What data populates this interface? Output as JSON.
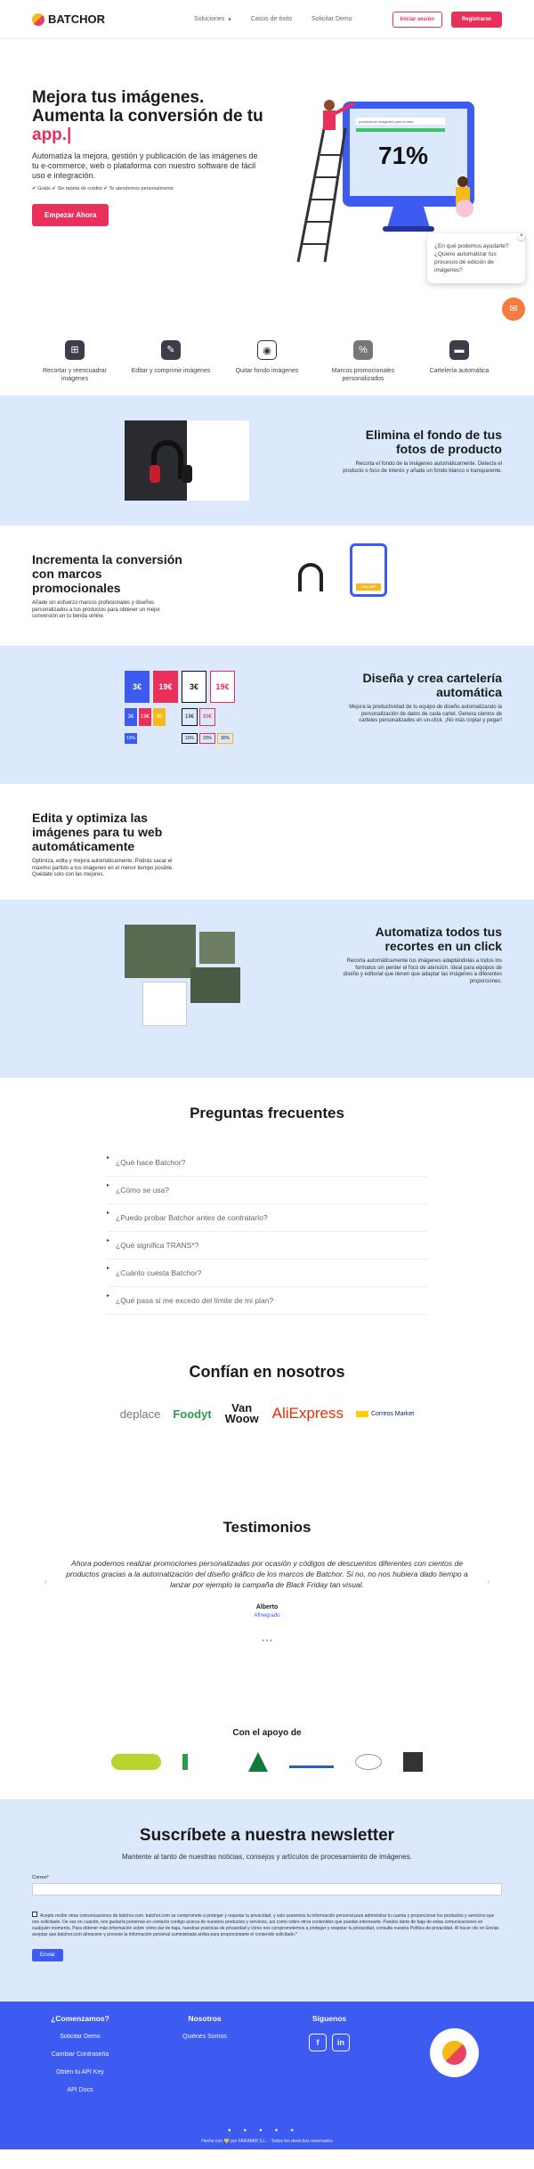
{
  "header": {
    "brand": "BATCHOR",
    "nav": [
      "Soluciones",
      "Casos de éxito",
      "Solicitar Demo"
    ],
    "login": "Iniciar sesión",
    "register": "Registrarse"
  },
  "hero": {
    "title": "Mejora tus imágenes. Aumenta la conversión de tu",
    "highlight": "app.|",
    "text": "Automatiza la mejora, gestión y publicación de las imágenes de tu e-commerce, web o plataforma con nuestro software de fácil uso e integración.",
    "checks": "✔ Gratis ✔ Sin tarjeta de crédito ✔ Te atendemos personalmente",
    "cta": "Empezar Ahora",
    "screen_pct": "71%",
    "screen_caption": "procesando imágenes para tu web..."
  },
  "chat": {
    "text": "¿En qué podemos ayudarle? ¿Quiere automatizar tus procesos de edición de imágenes?",
    "close": "×",
    "fab": "✉"
  },
  "features": [
    {
      "label": "Recortar y reencuadrar imágenes"
    },
    {
      "label": "Editar y comprimir imágenes"
    },
    {
      "label": "Quitar fondo imágenes"
    },
    {
      "label": "Marcos promocionales personalizados"
    },
    {
      "label": "Cartelería automática"
    }
  ],
  "sections": [
    {
      "title": "Elimina el fondo de tus fotos de producto",
      "desc": "Recorta el fondo de la imágenes automáticamente. Detecta el producto o foco de interés y añade un fondo blanco o transparente."
    },
    {
      "title": "Incrementa la conversión con marcos promocionales",
      "desc": "Añade sin esfuerzo marcos profesionales y diseños personalizados a tus productos para obtener un mejor conversión en tu tienda online.",
      "badge": "15% OFF"
    },
    {
      "title": "Diseña y crea cartelería automática",
      "desc": "Mejora la productividad de tu equipo de diseño automatizando la personalización de datos de cada cartel. Genera cientos de carteles personalizados en un-click. ¡No más copiar y pegar!",
      "prices": [
        "3€",
        "19€",
        "3€",
        "19€",
        "3€",
        "19€",
        "3€",
        "19€",
        "99€",
        "10%",
        "20%",
        "30%"
      ]
    },
    {
      "title": "Edita y optimiza las imágenes para tu web automáticamente",
      "desc": "Optimiza, edita y mejora automáticamente. Podrás sacar el máximo partido a tus imágenes en el menor tiempo posible. Quédate solo con las mejores."
    },
    {
      "title": "Automatiza todos tus recortes en un click",
      "desc": "Recorta automáticamente tus imágenes adaptándolas a todos los formatos sin perder el foco de atención. Ideal para equipos de diseño y editorial que tienen que adaptar las imágenes a diferentes proporciones."
    }
  ],
  "faq": {
    "title": "Preguntas frecuentes",
    "items": [
      "¿Qué hace Batchor?",
      "¿Cómo se usa?",
      "¿Puedo probar Batchor antes de contratarlo?",
      "¿Qué significa TRANS*?",
      "¿Cuánto cuesta Batchor?",
      "¿Qué pasa si me excedo del límite de mi plan?"
    ]
  },
  "trust": {
    "title": "Confían en nosotros",
    "logos": [
      "deplace",
      "Foodyt",
      "Van Woow",
      "AliExpress",
      "Correos Market"
    ]
  },
  "testimonials": {
    "title": "Testimonios",
    "quote": "Ahora podemos realizar promociones personalizadas por ocasión y códigos de descuentos diferentes con cientos de productos gracias a la automatización del diseño gráfico de los marcos de Batchor. Si no, no nos hubiera dado tiempo a lanzar por ejemplo la campaña de Black Friday tan visual.",
    "author": "Alberto",
    "company": "Afinegrado",
    "prev": "‹",
    "next": "›"
  },
  "support": {
    "title": "Con el apoyo de"
  },
  "newsletter": {
    "title": "Suscríbete a nuestra newsletter",
    "sub": "Mantente al tanto de nuestras noticias, consejos y artículos de procesamiento de imágenes.",
    "email_label": "Correo*",
    "legal": "Acepto recibir otras comunicaciones de batchor.com. batchor.com se compromete a proteger y respetar tu privacidad, y solo usaremos tu información personal para administrar tu cuenta y proporcionar los productos y servicios que nos solicitaste. De vez en cuando, nos gustaría ponernos en contacto contigo acerca de nuestros productos y servicios, así como sobre otros contenidos que puedan interesarte. Puedes darte de baja de estas comunicaciones en cualquier momento. Para obtener más información sobre cómo dar de baja, nuestras prácticas de privacidad y cómo nos comprometemos a proteger y respetar tu privacidad, consulta nuestra Política de privacidad. Al hacer clic en Enviar, aceptas que batchor.com almacene y procese la información personal suministrada arriba para proporcionarte el contenido solicitado.*",
    "send": "Enviar"
  },
  "footer": {
    "col1_title": "¿Comenzamos?",
    "col1": [
      "Solicitar Demo",
      "Cambiar Contraseña",
      "Obtén tu API Key",
      "API Docs"
    ],
    "col2_title": "Nosotros",
    "col2": [
      "Quiénes Somos"
    ],
    "col3_title": "Síguenos",
    "social": [
      "f",
      "in"
    ],
    "copy": "Hecho con 💛 por FARAMIR S.L. · Todos los derechos reservados"
  },
  "colors": {
    "accent": "#e8305b",
    "blue": "#3d5af1",
    "band": "#dce8fb"
  }
}
